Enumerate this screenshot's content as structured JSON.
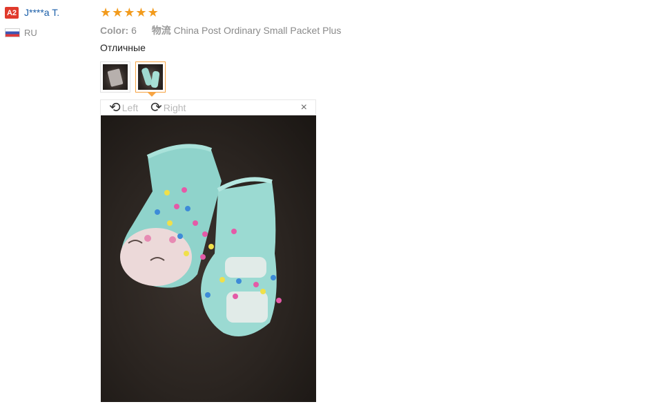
{
  "reviewer": {
    "avatar_text": "A2",
    "name": "J****a T.",
    "country": "RU"
  },
  "review": {
    "rating": 5,
    "star_glyph": "★",
    "star_color": "#f29b1d",
    "color_label": "Color:",
    "color_value": "6",
    "shipping_label": "物流",
    "shipping_value": "China Post Ordinary Small Packet Plus",
    "text": "Отличные"
  },
  "viewer": {
    "rotate_left_label": "Left",
    "rotate_right_label": "Right",
    "rotate_left_glyph": "⟲",
    "rotate_right_glyph": "⟳",
    "close_glyph": "×",
    "selected_index": 1,
    "thumbnail_count": 2
  }
}
